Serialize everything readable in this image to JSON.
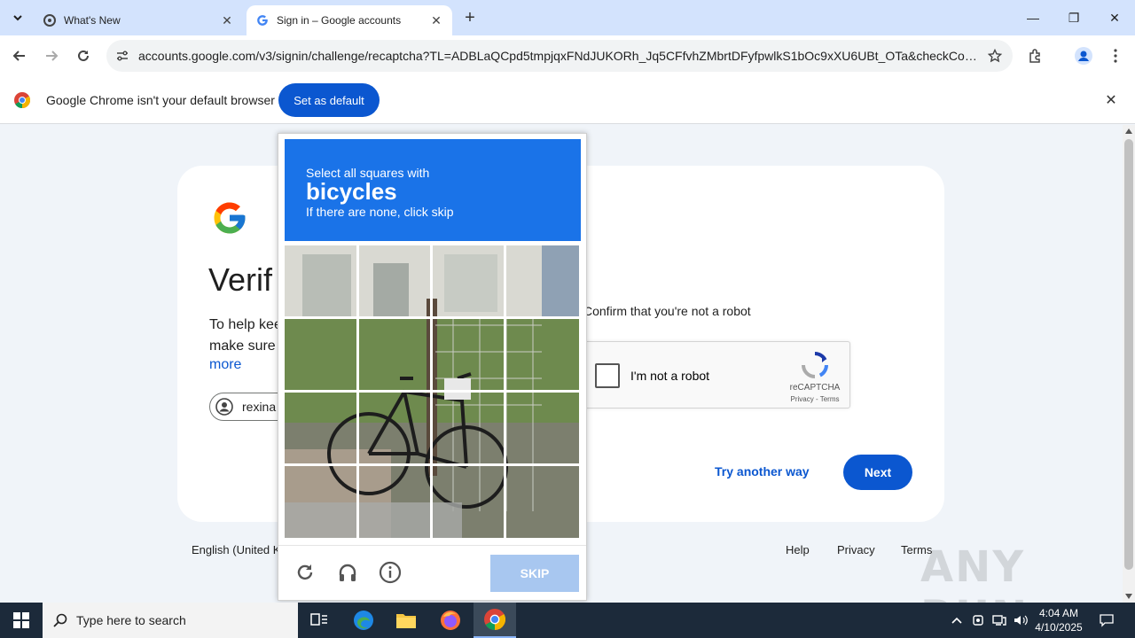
{
  "browser": {
    "tabs": [
      {
        "title": "What's New",
        "active": false
      },
      {
        "title": "Sign in – Google accounts",
        "active": true
      }
    ],
    "url": "accounts.google.com/v3/signin/challenge/recaptcha?TL=ADBLaQCpd5tmpjqxFNdJUKORh_Jq5CFfvhZMbrtDFyfpwlkS1bOc9xXU6UBt_OTa&checkConnec..."
  },
  "infobar": {
    "message": "Google Chrome isn't your default browser",
    "button": "Set as default"
  },
  "signin": {
    "heading": "Verif",
    "help_line1": "To help kee",
    "help_line2": "make sure",
    "more_link": "more",
    "account": "rexina",
    "confirm_text": "Confirm that you're not a robot",
    "recaptcha_label": "I'm not a robot",
    "recaptcha_brand": "reCAPTCHA",
    "recaptcha_terms": "Privacy - Terms",
    "try_another": "Try another way",
    "next": "Next"
  },
  "footer": {
    "language": "English (United Ki",
    "help": "Help",
    "privacy": "Privacy",
    "terms": "Terms"
  },
  "captcha": {
    "instruction": "Select all squares with",
    "target": "bicycles",
    "sub": "If there are none, click skip",
    "skip": "SKIP",
    "colors": {
      "header": "#1a73e8",
      "skip": "#a8c7f0"
    }
  },
  "watermark": "ANY RUN",
  "taskbar": {
    "search_placeholder": "Type here to search",
    "time": "4:04 AM",
    "date": "4/10/2025"
  }
}
